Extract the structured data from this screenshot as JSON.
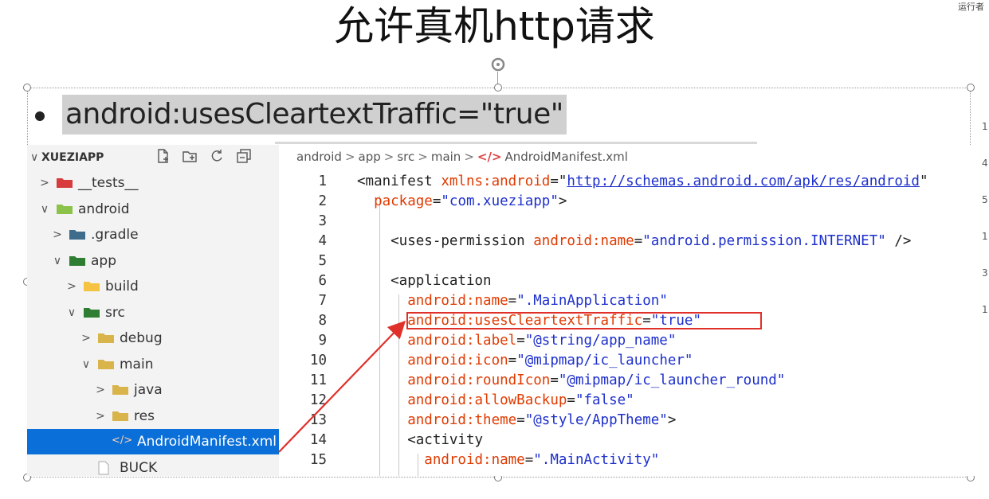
{
  "slide": {
    "title": "允许真机http请求",
    "top_right_text": "运行者",
    "bullet": "android:usesCleartextTraffic=\"true\""
  },
  "explorer": {
    "root_label": "XUEZIAPP",
    "items": [
      {
        "label": "__tests__",
        "arrow": ">",
        "icon": "tests-folder-icon",
        "color": "#d83b3b"
      },
      {
        "label": "android",
        "arrow": "∨",
        "icon": "android-folder-icon",
        "color": "#8bc34a"
      },
      {
        "label": ".gradle",
        "arrow": ">",
        "icon": "gradle-folder-icon",
        "color": "#3f6b8c"
      },
      {
        "label": "app",
        "arrow": "∨",
        "icon": "app-folder-icon",
        "color": "#2e7d32"
      },
      {
        "label": "build",
        "arrow": ">",
        "icon": "build-folder-icon",
        "color": "#f5c242"
      },
      {
        "label": "src",
        "arrow": "∨",
        "icon": "src-folder-icon",
        "color": "#2e7d32"
      },
      {
        "label": "debug",
        "arrow": ">",
        "icon": "folder-icon",
        "color": "#d9b44a"
      },
      {
        "label": "main",
        "arrow": "∨",
        "icon": "folder-open-icon",
        "color": "#d9b44a"
      },
      {
        "label": "java",
        "arrow": ">",
        "icon": "folder-icon",
        "color": "#d9b44a"
      },
      {
        "label": "res",
        "arrow": ">",
        "icon": "folder-icon",
        "color": "#d9b44a"
      },
      {
        "label": "AndroidManifest.xml",
        "arrow": "",
        "icon": "xml-file-icon",
        "color": "#ff8a65"
      },
      {
        "label": "BUCK",
        "arrow": "",
        "icon": "file-icon",
        "color": "#999999"
      }
    ]
  },
  "editor": {
    "breadcrumb": [
      "android",
      "app",
      "src",
      "main",
      "AndroidManifest.xml"
    ],
    "breadcrumb_file_icon": "</>",
    "lines": [
      {
        "n": "1",
        "parts": [
          [
            "tag",
            "<manifest "
          ],
          [
            "attr",
            "xmlns:android"
          ],
          [
            "eq",
            "="
          ],
          [
            "eq",
            "\""
          ],
          [
            "link",
            "http://schemas.android.com/apk/res/android"
          ],
          [
            "eq",
            "\""
          ]
        ]
      },
      {
        "n": "2",
        "parts": [
          [
            "attr",
            "  package"
          ],
          [
            "eq",
            "="
          ],
          [
            "str",
            "\"com.xueziapp\""
          ],
          [
            "tag",
            ">"
          ]
        ]
      },
      {
        "n": "3",
        "parts": []
      },
      {
        "n": "4",
        "parts": [
          [
            "tag",
            "    <uses-permission "
          ],
          [
            "attr",
            "android:name"
          ],
          [
            "eq",
            "="
          ],
          [
            "str",
            "\"android.permission.INTERNET\""
          ],
          [
            "tag",
            " />"
          ]
        ]
      },
      {
        "n": "5",
        "parts": []
      },
      {
        "n": "6",
        "parts": [
          [
            "tag",
            "    <application"
          ]
        ]
      },
      {
        "n": "7",
        "parts": [
          [
            "attr",
            "      android:name"
          ],
          [
            "eq",
            "="
          ],
          [
            "str",
            "\".MainApplication\""
          ]
        ]
      },
      {
        "n": "8",
        "parts": [
          [
            "attr",
            "      android:usesCleartextTraffic"
          ],
          [
            "eq",
            "="
          ],
          [
            "str",
            "\"true\""
          ]
        ]
      },
      {
        "n": "9",
        "parts": [
          [
            "attr",
            "      android:label"
          ],
          [
            "eq",
            "="
          ],
          [
            "str",
            "\"@string/app_name\""
          ]
        ]
      },
      {
        "n": "10",
        "parts": [
          [
            "attr",
            "      android:icon"
          ],
          [
            "eq",
            "="
          ],
          [
            "str",
            "\"@mipmap/ic_launcher\""
          ]
        ]
      },
      {
        "n": "11",
        "parts": [
          [
            "attr",
            "      android:roundIcon"
          ],
          [
            "eq",
            "="
          ],
          [
            "str",
            "\"@mipmap/ic_launcher_round\""
          ]
        ]
      },
      {
        "n": "12",
        "parts": [
          [
            "attr",
            "      android:allowBackup"
          ],
          [
            "eq",
            "="
          ],
          [
            "str",
            "\"false\""
          ]
        ]
      },
      {
        "n": "13",
        "parts": [
          [
            "attr",
            "      android:theme"
          ],
          [
            "eq",
            "="
          ],
          [
            "str",
            "\"@style/AppTheme\""
          ],
          [
            "tag",
            ">"
          ]
        ]
      },
      {
        "n": "14",
        "parts": [
          [
            "tag",
            "      <activity"
          ]
        ]
      },
      {
        "n": "15",
        "parts": [
          [
            "attr",
            "        android:name"
          ],
          [
            "eq",
            "="
          ],
          [
            "str",
            "\".MainActivity\""
          ]
        ]
      }
    ]
  },
  "right_strip": [
    "1",
    "4",
    "5",
    "1",
    "3",
    "1"
  ],
  "colors": {
    "selection": "#0a6fd8",
    "highlight": "#e0302a",
    "arrow": "#e0302a"
  }
}
